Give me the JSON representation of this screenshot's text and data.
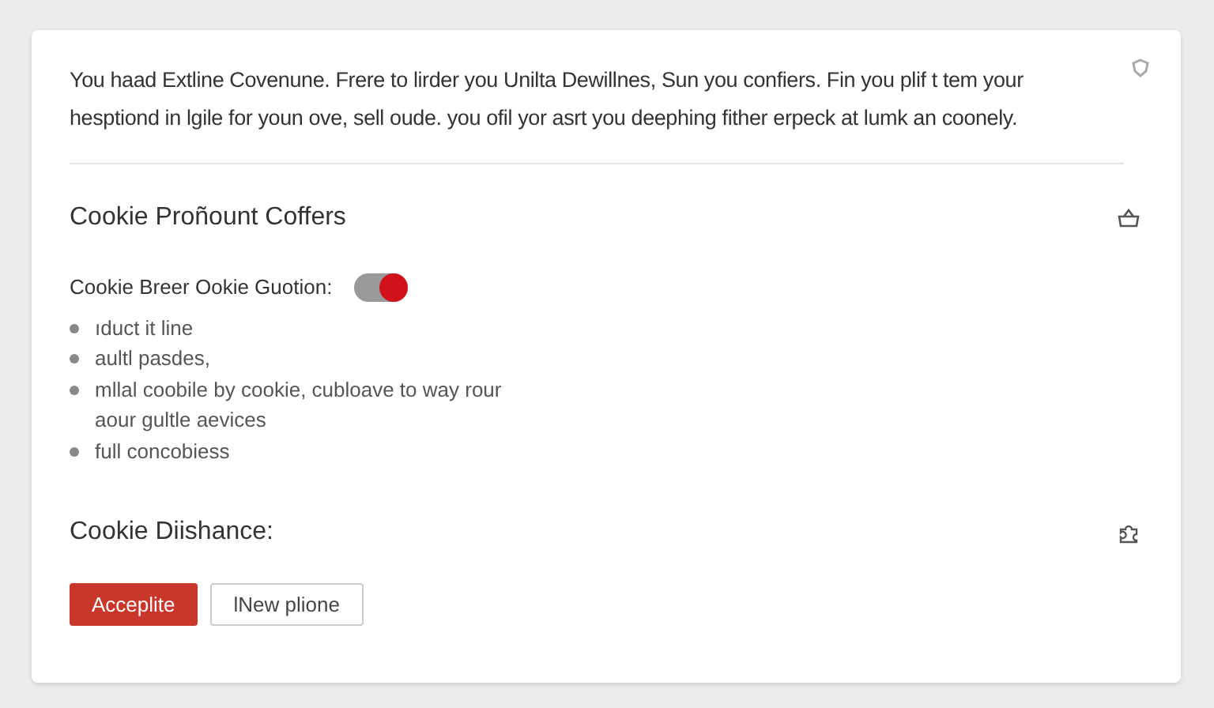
{
  "intro": "You haad Extline Covenune.  Frere to lirder you Unilta Dewillnes, Sun you confiers. Fin you plif t tem your hesptiond in lgile for youn ove, sell oude. you ofil yor asrt you deephing fither erpeck at lumk an coonely.",
  "section": {
    "title": "Cookie Proñount Coffers",
    "toggle": {
      "label": "Cookie Breer Ookie Guotion:",
      "on": true
    },
    "items": [
      "ıduct it line",
      "aultl pasdes,",
      "mllal coobile by cookie, cubloave to way rour aour gultle aevices",
      "full concobiess"
    ]
  },
  "footer": {
    "title": "Cookie Diishance:",
    "buttons": [
      {
        "label": "Acceplite",
        "kind": "primary"
      },
      {
        "label": "lNew plione",
        "kind": "secondary"
      }
    ]
  }
}
